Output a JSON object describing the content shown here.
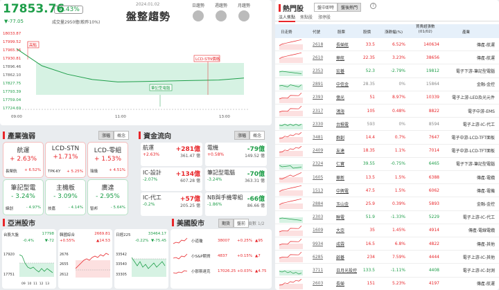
{
  "header": {
    "index_value": "17853.76",
    "change_pct": "-0.43%",
    "change": "▼-77.05",
    "volume": "成交量2950億(較昨10%)",
    "date": "2024.01.02",
    "title": "盤整趨勢",
    "tabs": [
      "日趨勢",
      "週趨勢",
      "月趨勢"
    ]
  },
  "main_chart": {
    "ylabels": [
      "18033.87",
      "17999.52",
      "17965.16",
      "17930.81",
      "17896.46",
      "17862.10",
      "17827.75",
      "17793.39",
      "17759.04",
      "17724.69"
    ],
    "xlabels": [
      "09:00",
      "11:00",
      "13:00"
    ],
    "tags": [
      "高點",
      "LCD-STN價格",
      "筆記型電腦"
    ]
  },
  "chart_data": {
    "type": "line",
    "title": "盤整趨勢",
    "xlabel": "",
    "ylabel": "",
    "ylim": [
      17724.69,
      18033.87
    ],
    "x": [
      "09:00",
      "09:30",
      "10:00",
      "10:30",
      "11:00",
      "11:30",
      "12:00",
      "12:30",
      "13:00",
      "13:30"
    ],
    "y": [
      17975,
      17905,
      17870,
      17848,
      17838,
      17840,
      17842,
      17844,
      17846,
      17854
    ]
  },
  "industry": {
    "title": "產業強弱",
    "buttons": [
      "漲幅",
      "概念"
    ],
    "cards": [
      {
        "name": "航運",
        "pct": "+ 2.63%",
        "sub": "長榮航",
        "subpct": "+ 6.52%"
      },
      {
        "name": "LCD-STN",
        "pct": "+1.71%",
        "sub": "TPK-KY",
        "subpct": "+ 5.25%"
      },
      {
        "name": "LCD-零組",
        "pct": "+ 1.53%",
        "sub": "瑞儀",
        "subpct": "+ 4.51%"
      },
      {
        "name": "筆記型電",
        "pct": "- 3.24%",
        "sub": "緯創",
        "subpct": "- 4.97%"
      },
      {
        "name": "主機板",
        "pct": "- 3.09%",
        "sub": "技嘉",
        "subpct": "- 4.14%"
      },
      {
        "name": "廣達",
        "pct": "- 2.95%",
        "sub": "智邦",
        "subpct": "- 5.64%"
      }
    ]
  },
  "capital": {
    "title": "資金流向",
    "buttons": [
      "漲幅",
      "概念"
    ],
    "items": [
      {
        "name": "航運",
        "pct": "+2.63%",
        "val": "+281億",
        "vol": "361.47 億"
      },
      {
        "name": "電機",
        "pct": "+0.58%",
        "val": "-79億",
        "vol": "149.52 億"
      },
      {
        "name": "IC-設計",
        "pct": "-2.07%",
        "val": "+134億",
        "vol": "607.28 億"
      },
      {
        "name": "筆記型電腦",
        "pct": "-3.24%",
        "val": "-70億",
        "vol": "363.31 億"
      },
      {
        "name": "IC-代工",
        "pct": "-0.2%",
        "val": "+57億",
        "vol": "205.25 億"
      },
      {
        "name": "NB與手機零組",
        "pct": "-1.86%",
        "val": "-66億",
        "vol": "86.66 億"
      }
    ]
  },
  "asia": {
    "title": "亞洲股市",
    "markets": [
      {
        "name": "台股大盤",
        "value": "17798",
        "pct": "-0.4%",
        "chg": "▼-72",
        "yt": "17920",
        "yb": "17751",
        "x": "09  10  11  12  13"
      },
      {
        "name": "韓國綜合",
        "value": "2669.81",
        "pct": "+0.55%",
        "chg": "▲14.53",
        "yt": "2676",
        "yb": "2612",
        "x": ""
      },
      {
        "name": "日經225",
        "value": "33464.17",
        "pct": "-0.22%",
        "chg": "▼-75.45",
        "yt": "33542",
        "yb": "33305",
        "x": ""
      }
    ],
    "ymid": [
      "",
      "2655",
      "33540"
    ]
  },
  "us": {
    "title": "美國股市",
    "buttons": [
      "期貨",
      "盤前"
    ],
    "page": "1/2",
    "rows": [
      {
        "name": "小道瓊",
        "val": "38007",
        "pct": "+0.25%",
        "chg": "▲95"
      },
      {
        "name": "小S&P期貨",
        "val": "4837",
        "pct": "+0.15%",
        "chg": "▲7"
      },
      {
        "name": "小那斯達克",
        "val": "17026.25",
        "pct": "+0.03%",
        "chg": "▲4.75"
      }
    ]
  },
  "hot": {
    "title": "熱門股",
    "tabs": [
      "盤中即時",
      "盤後熱門"
    ],
    "subtabs": [
      "法人焦點",
      "焦點股",
      "漲停股"
    ],
    "headers": [
      "日走勢",
      "代號",
      "股票",
      "股價",
      "漲跌幅(%)",
      "買賣超張數\n(01/02)",
      "產業"
    ],
    "rows": [
      {
        "code": "2618",
        "name": "長榮航",
        "price": "33.5",
        "pct": "6.52%",
        "vol": "140634",
        "ind": "傳產-航運",
        "up": true
      },
      {
        "code": "2610",
        "name": "華航",
        "price": "22.35",
        "pct": "3.23%",
        "vol": "38656",
        "ind": "傳產-航運",
        "up": true
      },
      {
        "code": "2353",
        "name": "宏碁",
        "price": "52.3",
        "pct": "-2.79%",
        "vol": "19812",
        "ind": "電子下游-筆記型電腦",
        "up": false
      },
      {
        "code": "2891",
        "name": "中信金",
        "price": "28.35",
        "pct": "0%",
        "vol": "15864",
        "ind": "金融-金控",
        "up": null
      },
      {
        "code": "2393",
        "name": "億光",
        "price": "51",
        "pct": "8.97%",
        "vol": "10339",
        "ind": "電子上游-LED及光元件",
        "up": true
      },
      {
        "code": "2317",
        "name": "鴻海",
        "price": "105",
        "pct": "0.48%",
        "vol": "8822",
        "ind": "電子中游-EMS",
        "up": true
      },
      {
        "code": "2330",
        "name": "台積電",
        "price": "593",
        "pct": "0%",
        "vol": "8594",
        "ind": "電子上游-IC-代工",
        "up": null
      },
      {
        "code": "3481",
        "name": "群創",
        "price": "14.4",
        "pct": "0.7%",
        "vol": "7647",
        "ind": "電子中游-LCD-TFT面板",
        "up": true
      },
      {
        "code": "2409",
        "name": "友達",
        "price": "18.35",
        "pct": "1.1%",
        "vol": "7014",
        "ind": "電子中游-LCD-TFT面板",
        "up": true
      },
      {
        "code": "2324",
        "name": "仁寶",
        "price": "39.55",
        "pct": "-0.75%",
        "vol": "6465",
        "ind": "電子下游-筆記型電腦",
        "up": false
      },
      {
        "code": "1605",
        "name": "華新",
        "price": "13.5",
        "pct": "1.5%",
        "vol": "6388",
        "ind": "傳產-電纜",
        "up": true
      },
      {
        "code": "1513",
        "name": "中興電",
        "price": "47.5",
        "pct": "1.5%",
        "vol": "6062",
        "ind": "傳產-電機",
        "up": true
      },
      {
        "code": "2884",
        "name": "玉山金",
        "price": "25.9",
        "pct": "0.39%",
        "vol": "5893",
        "ind": "金融-金控",
        "up": true
      },
      {
        "code": "2303",
        "name": "聯電",
        "price": "51.9",
        "pct": "-1.33%",
        "vol": "5229",
        "ind": "電子上游-IC-代工",
        "up": false
      },
      {
        "code": "1609",
        "name": "大亞",
        "price": "35",
        "pct": "1.45%",
        "vol": "4914",
        "ind": "傳產-電線電纜",
        "up": true
      },
      {
        "code": "9934",
        "name": "成霖",
        "price": "16.5",
        "pct": "6.8%",
        "vol": "4822",
        "ind": "傳產-其他",
        "up": true
      },
      {
        "code": "6285",
        "name": "啟碁",
        "price": "234",
        "pct": "7.59%",
        "vol": "4444",
        "ind": "電子上游-IC-其他",
        "up": true
      },
      {
        "code": "3711",
        "name": "日月光投控",
        "price": "133.5",
        "pct": "-1.11%",
        "vol": "4408",
        "ind": "電子上游-IC-封測",
        "up": false
      },
      {
        "code": "2603",
        "name": "長榮",
        "price": "151",
        "pct": "5.23%",
        "vol": "4197",
        "ind": "傳產-航運",
        "up": true
      }
    ]
  },
  "colors": {
    "up": "#e8262a",
    "down": "#1e9e49",
    "flat": "#888888",
    "accent": "#e8262a"
  }
}
